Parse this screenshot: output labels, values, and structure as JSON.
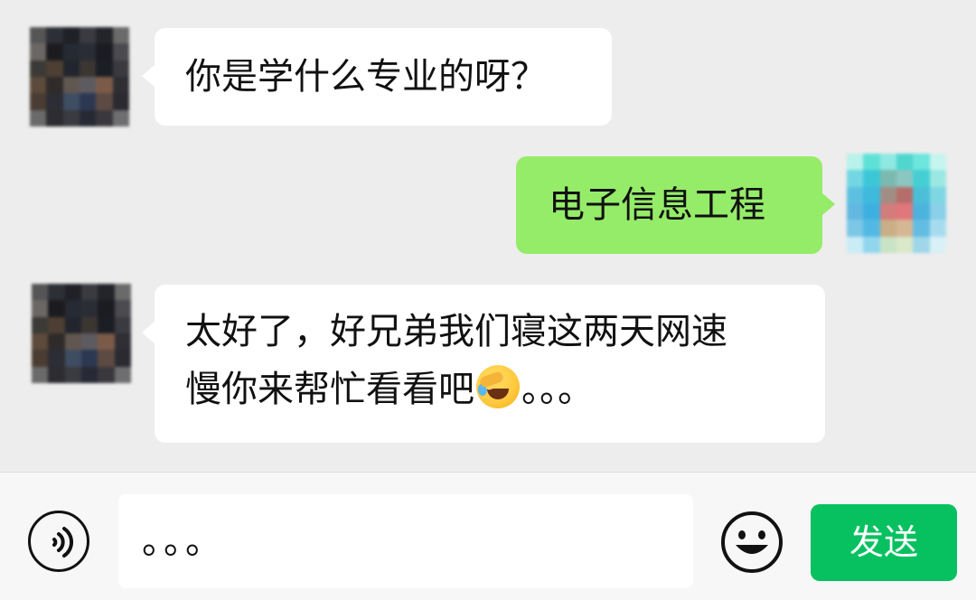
{
  "messages": [
    {
      "side": "incoming",
      "text": "你是学什么专业的呀？"
    },
    {
      "side": "outgoing",
      "text": "电子信息工程"
    },
    {
      "side": "incoming",
      "line1": "太好了，好兄弟我们寝这两天网速",
      "line2": "慢你来帮忙看看吧",
      "emoji": "face-palm-crying-emoji",
      "trail": "。。。"
    }
  ],
  "input": {
    "value": "。。。"
  },
  "send_button": {
    "label": "发送"
  },
  "icons": {
    "voice": "voice-icon",
    "emoji": "emoji-smiley-icon"
  },
  "colors": {
    "incoming_bubble": "#ffffff",
    "outgoing_bubble": "#95ec69",
    "send_button": "#07c160",
    "background": "#ededed"
  }
}
